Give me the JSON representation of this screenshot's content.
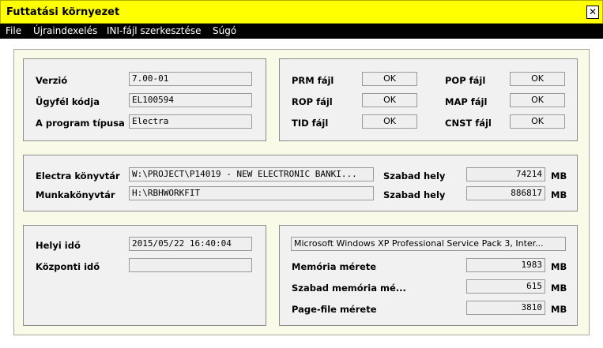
{
  "window": {
    "title": "Futtatási környezet",
    "close_glyph": "✕"
  },
  "menu": [
    "File",
    "Újraindexelés",
    "INI-fájl szerkesztése",
    "Súgó"
  ],
  "version_panel": {
    "version_label": "Verzió",
    "version_value": "7.00-01",
    "client_label": "Ügyfél kódja",
    "client_value": "EL100594",
    "type_label": "A program típusa",
    "type_value": "Electra"
  },
  "files_panel": {
    "prm_label": "PRM fájl",
    "prm_status": "OK",
    "rop_label": "ROP fájl",
    "rop_status": "OK",
    "tid_label": "TID fájl",
    "tid_status": "OK",
    "pop_label": "POP fájl",
    "pop_status": "OK",
    "map_label": "MAP fájl",
    "map_status": "OK",
    "cnst_label": "CNST fájl",
    "cnst_status": "OK"
  },
  "dirs_panel": {
    "electra_dir_label": "Electra könyvtár",
    "electra_dir_value": "W:\\PROJECT\\P14019 - NEW ELECTRONIC BANKI...",
    "electra_free_label": "Szabad hely",
    "electra_free_value": "74214",
    "electra_free_unit": "MB",
    "work_dir_label": "Munkakönyvtár",
    "work_dir_value": "H:\\RBHWORKFIT",
    "work_free_label": "Szabad hely",
    "work_free_value": "886817",
    "work_free_unit": "MB"
  },
  "time_panel": {
    "local_label": "Helyi idő",
    "local_value": "2015/05/22 16:40:04",
    "central_label": "Központi idő",
    "central_value": ""
  },
  "system_panel": {
    "os_value": "Microsoft Windows XP Professional Service Pack 3, Inter...",
    "mem_label": "Memória mérete",
    "mem_value": "1983",
    "mem_unit": "MB",
    "free_mem_label": "Szabad memória mé...",
    "free_mem_value": "615",
    "free_mem_unit": "MB",
    "pagefile_label": "Page-file mérete",
    "pagefile_value": "3810",
    "pagefile_unit": "MB"
  }
}
